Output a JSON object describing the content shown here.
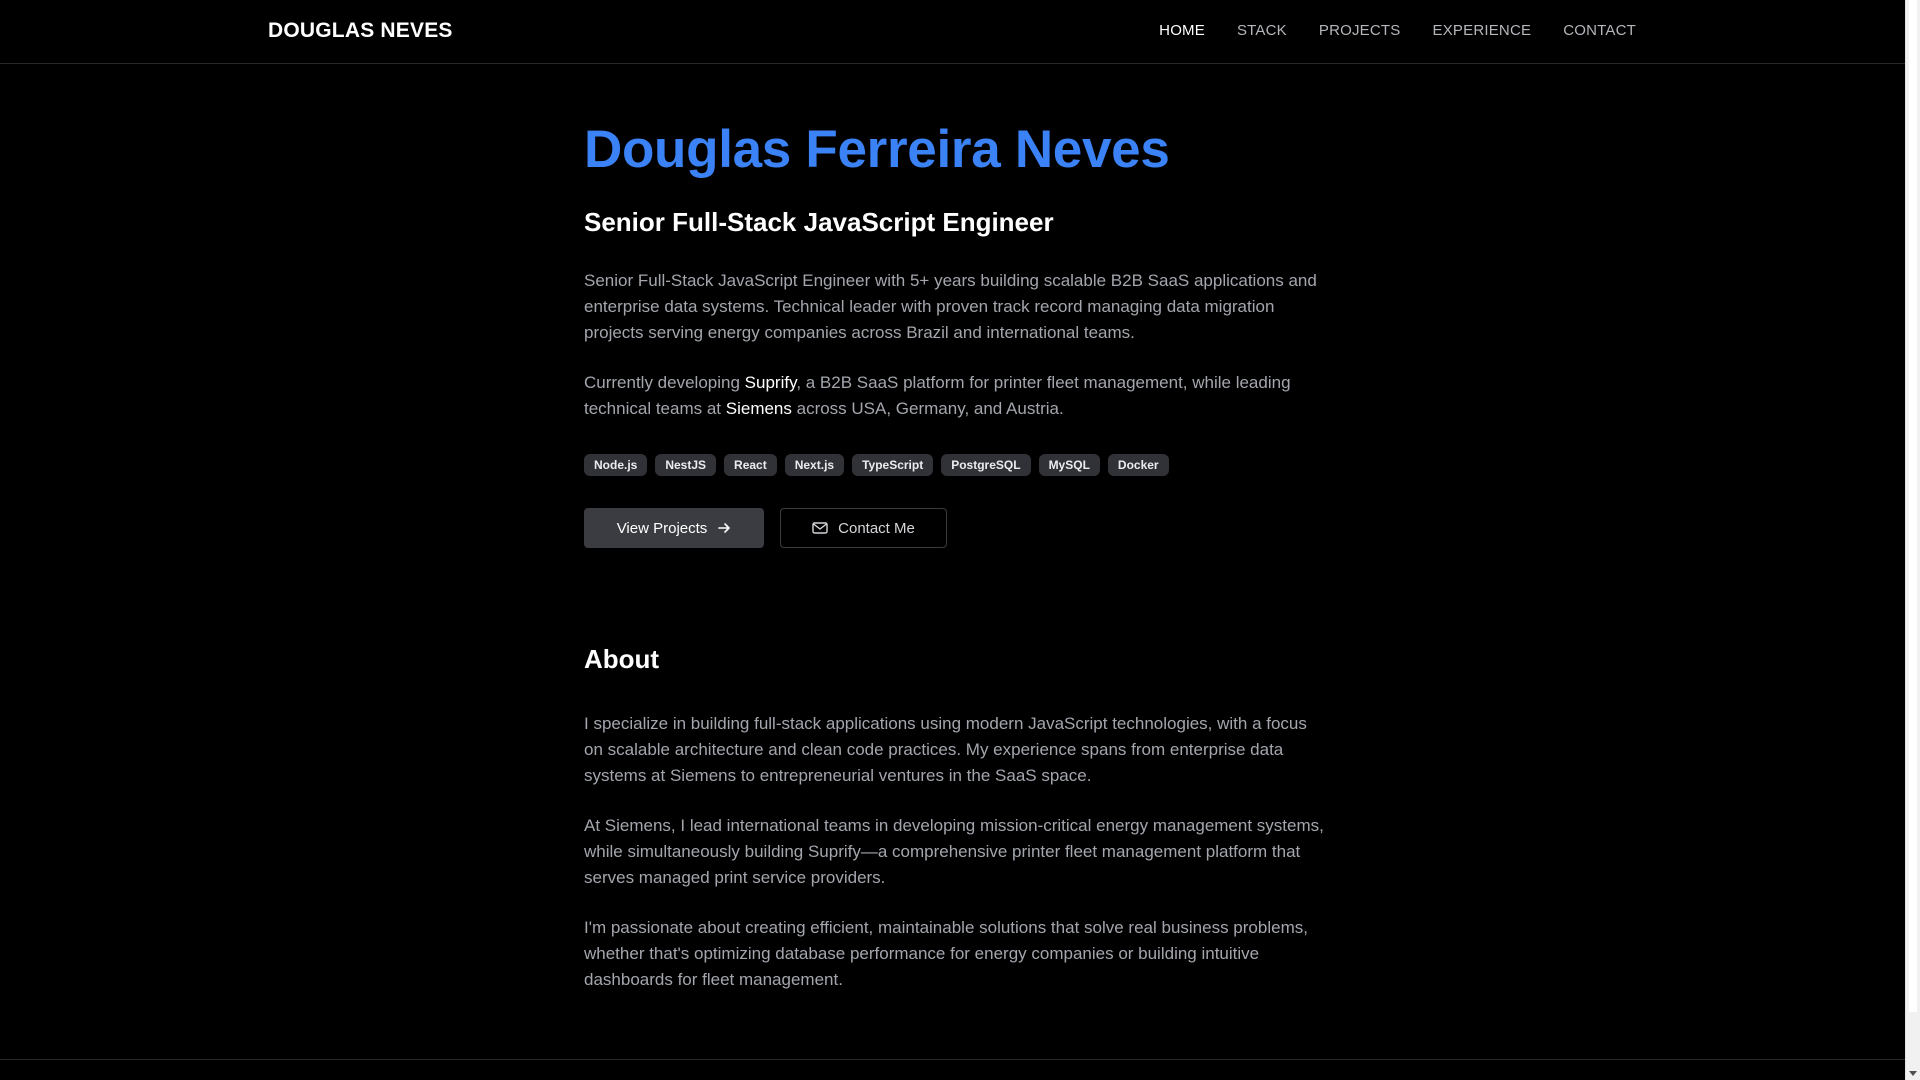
{
  "header": {
    "brand": "DOUGLAS NEVES",
    "nav": [
      {
        "label": "HOME",
        "active": true
      },
      {
        "label": "STACK",
        "active": false
      },
      {
        "label": "PROJECTS",
        "active": false
      },
      {
        "label": "EXPERIENCE",
        "active": false
      },
      {
        "label": "CONTACT",
        "active": false
      }
    ]
  },
  "hero": {
    "name": "Douglas Ferreira Neves",
    "role": "Senior Full-Stack JavaScript Engineer",
    "intro": "Senior Full-Stack JavaScript Engineer with 5+ years building scalable B2B SaaS applications and enterprise data systems. Technical leader with proven track record managing data migration projects serving energy companies across Brazil and international teams.",
    "current": {
      "prefix": "Currently developing ",
      "highlight1": "Suprify",
      "middle": ", a B2B SaaS platform for printer fleet management, while leading technical teams at ",
      "highlight2": "Siemens",
      "suffix": " across USA, Germany, and Austria."
    },
    "tags": [
      "Node.js",
      "NestJS",
      "React",
      "Next.js",
      "TypeScript",
      "PostgreSQL",
      "MySQL",
      "Docker"
    ],
    "buttons": {
      "primary": {
        "label": "View Projects",
        "icon": "arrow-right-icon"
      },
      "secondary": {
        "label": "Contact Me",
        "icon": "mail-icon"
      }
    }
  },
  "about": {
    "heading": "About",
    "paragraphs": [
      "I specialize in building full-stack applications using modern JavaScript technologies, with a focus on scalable architecture and clean code practices. My experience spans from enterprise data systems at Siemens to entrepreneurial ventures in the SaaS space.",
      "At Siemens, I lead international teams in developing mission-critical energy management systems, while simultaneously building Suprify—a comprehensive printer fleet management platform that serves managed print service providers.",
      "I'm passionate about creating efficient, maintainable solutions that solve real business problems, whether that's optimizing database performance for energy companies or building intuitive dashboards for fleet management."
    ]
  },
  "colors": {
    "accent": "#3b82f6",
    "background": "#000000",
    "text_muted": "#a3a6ad",
    "tag_bg": "#303238"
  }
}
